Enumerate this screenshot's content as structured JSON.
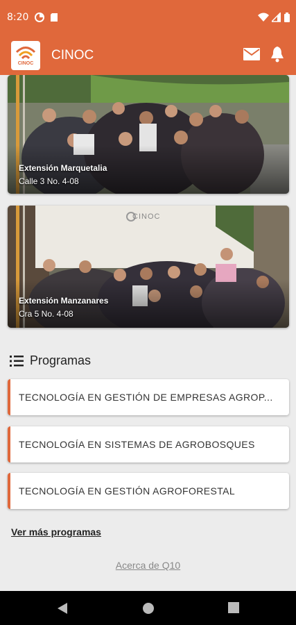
{
  "status_bar": {
    "time": "8:20"
  },
  "app_bar": {
    "logo_text": "CINOC",
    "title": "CINOC",
    "icons": [
      "mail-icon",
      "bell-icon"
    ]
  },
  "campuses": [
    {
      "name": "Extensión Marquetalia",
      "address": "Calle 3 No. 4-08"
    },
    {
      "name": "Extensión Manzanares",
      "address": "Cra 5 No. 4-08",
      "banner_text": "CINOC"
    }
  ],
  "programs_section": {
    "title": "Programas",
    "icon": "list-icon",
    "items": [
      {
        "label": "TECNOLOGÍA EN GESTIÓN DE EMPRESAS AGROP..."
      },
      {
        "label": "TECNOLOGÍA EN SISTEMAS DE AGROBOSQUES"
      },
      {
        "label": "TECNOLOGÍA EN GESTIÓN AGROFORESTAL"
      }
    ]
  },
  "more_programs_label": "Ver más programas",
  "about_label": "Acerca de Q10",
  "colors": {
    "primary": "#e0683b",
    "background": "#ececec"
  }
}
